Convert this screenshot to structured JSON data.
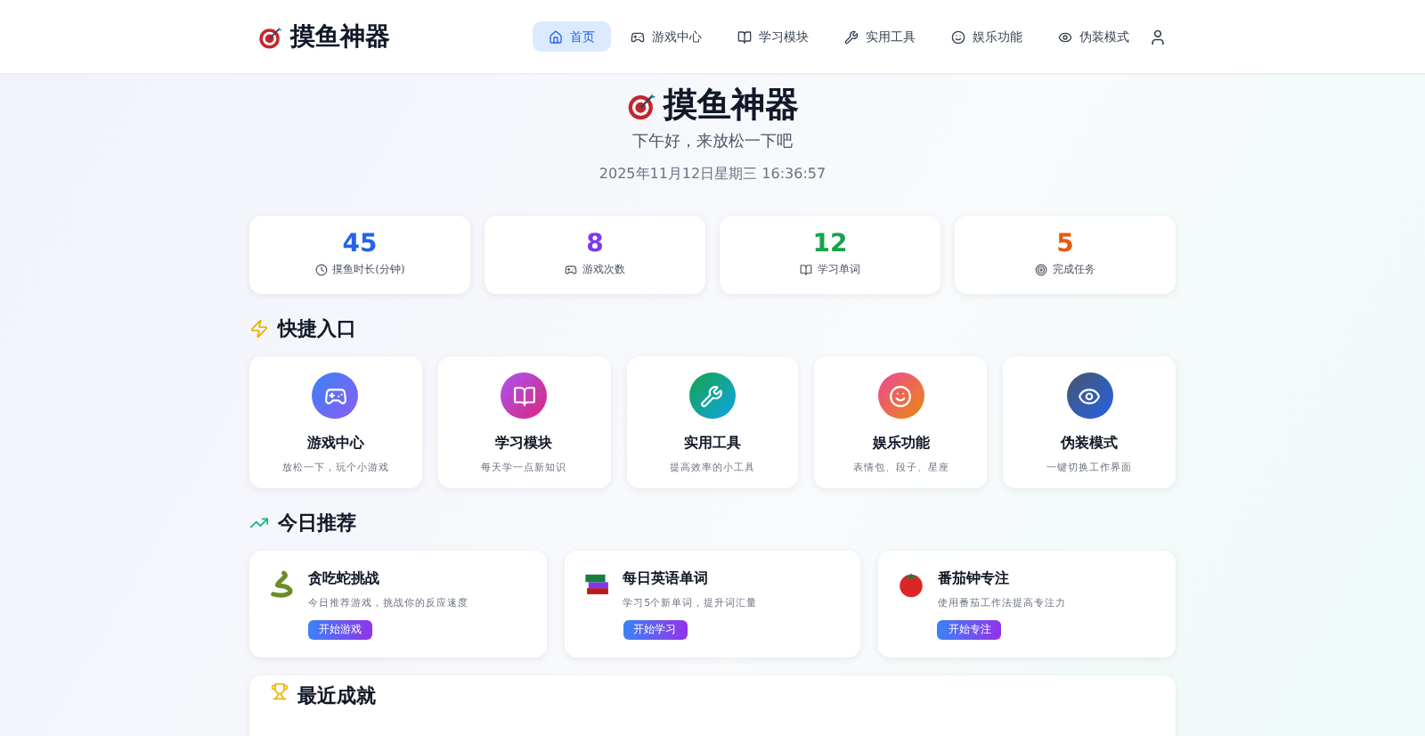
{
  "nav": {
    "brand": "摸鱼神器",
    "items": [
      {
        "label": "首页",
        "selected": true
      },
      {
        "label": "游戏中心",
        "selected": false
      },
      {
        "label": "学习模块",
        "selected": false
      },
      {
        "label": "实用工具",
        "selected": false
      },
      {
        "label": "娱乐功能",
        "selected": false
      },
      {
        "label": "伪装模式",
        "selected": false
      }
    ]
  },
  "hero": {
    "title": "摸鱼神器",
    "subtitle": "下午好，来放松一下吧",
    "datetime": "2025年11月12日星期三 16:36:57"
  },
  "stats": [
    {
      "value": "45",
      "label": "摸鱼时长(分钟)",
      "color": "#2563eb"
    },
    {
      "value": "8",
      "label": "游戏次数",
      "color": "#7c3aed"
    },
    {
      "value": "12",
      "label": "学习单词",
      "color": "#16a34a"
    },
    {
      "value": "5",
      "label": "完成任务",
      "color": "#ea580c"
    }
  ],
  "quick": {
    "title": "快捷入口",
    "items": [
      {
        "title": "游戏中心",
        "desc": "放松一下，玩个小游戏"
      },
      {
        "title": "学习模块",
        "desc": "每天学一点新知识"
      },
      {
        "title": "实用工具",
        "desc": "提高效率的小工具"
      },
      {
        "title": "娱乐功能",
        "desc": "表情包、段子、星座"
      },
      {
        "title": "伪装模式",
        "desc": "一键切换工作界面"
      }
    ]
  },
  "today": {
    "title": "今日推荐",
    "items": [
      {
        "title": "贪吃蛇挑战",
        "desc": "今日推荐游戏，挑战你的反应速度",
        "button": "开始游戏"
      },
      {
        "title": "每日英语单词",
        "desc": "学习5个新单词，提升词汇量",
        "button": "开始学习"
      },
      {
        "title": "番茄钟专注",
        "desc": "使用番茄工作法提高专注力",
        "button": "开始专注"
      }
    ]
  },
  "achievements": {
    "title": "最近成就"
  }
}
